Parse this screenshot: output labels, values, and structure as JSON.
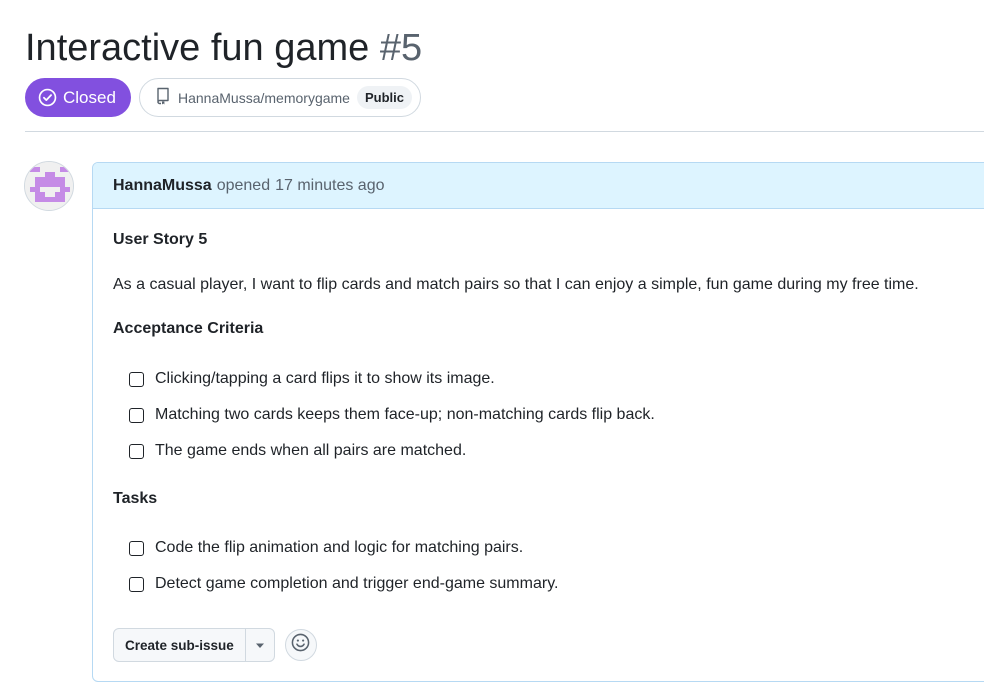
{
  "issue": {
    "title": "Interactive fun game",
    "number": "#5",
    "state": "Closed",
    "state_color": "#8250df",
    "state_icon": "check-circle-icon",
    "repo": "HannaMussa/memorygame",
    "repo_icon": "repo-icon",
    "visibility": "Public"
  },
  "comment": {
    "author": "HannaMussa",
    "action": "opened",
    "time": "17 minutes ago",
    "heading": "User Story 5",
    "story": "As a casual player, I want to flip cards and match pairs so that I can enjoy a simple, fun game during my free time.",
    "acceptance_heading": "Acceptance Criteria",
    "acceptance": [
      {
        "text": "Clicking/tapping a card flips it to show its image.",
        "checked": false
      },
      {
        "text": "Matching two cards keeps them face-up; non-matching cards flip back.",
        "checked": false
      },
      {
        "text": "The game ends when all pairs are matched.",
        "checked": false
      }
    ],
    "tasks_heading": "Tasks",
    "tasks": [
      {
        "text": "Code the flip animation and logic for matching pairs.",
        "checked": false
      },
      {
        "text": "Detect game completion and trigger end-game summary.",
        "checked": false
      }
    ]
  },
  "actions": {
    "create_sub_issue": "Create sub-issue",
    "dropdown_icon": "triangle-down-icon",
    "reaction_icon": "smiley-icon"
  }
}
